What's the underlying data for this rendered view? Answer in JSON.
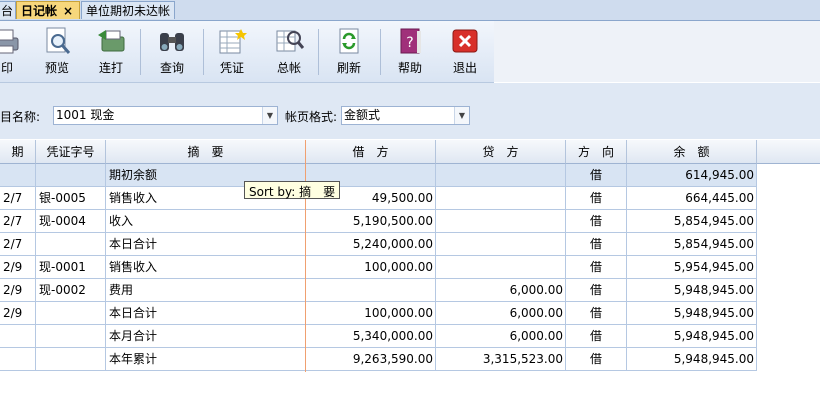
{
  "tabs": [
    {
      "label": "台",
      "active": false
    },
    {
      "label": "日记帐",
      "active": true,
      "close": "×"
    },
    {
      "label": "单位期初未达帐",
      "active": false
    }
  ],
  "toolbar": {
    "print": "印",
    "preview": "预览",
    "batch_print": "连打",
    "query": "查询",
    "voucher": "凭证",
    "ledger": "总帐",
    "refresh": "刷新",
    "help": "帮助",
    "exit": "退出"
  },
  "filters": {
    "subject_label": "目名称:",
    "subject_value": "1001 现金",
    "format_label": "帐页格式:",
    "format_value": "金额式"
  },
  "grid": {
    "headers": [
      "期",
      "凭证字号",
      "摘　要",
      "借　方",
      "贷　方",
      "方　向",
      "余　额"
    ],
    "rows": [
      {
        "date": "",
        "voucher": "",
        "summary": "期初余额",
        "debit": "",
        "credit": "",
        "dir": "借",
        "balance": "614,945.00"
      },
      {
        "date": "2/7",
        "voucher": "银-0005",
        "summary": "销售收入",
        "debit": "49,500.00",
        "credit": "",
        "dir": "借",
        "balance": "664,445.00"
      },
      {
        "date": "2/7",
        "voucher": "现-0004",
        "summary": "收入",
        "debit": "5,190,500.00",
        "credit": "",
        "dir": "借",
        "balance": "5,854,945.00"
      },
      {
        "date": "2/7",
        "voucher": "",
        "summary": "本日合计",
        "debit": "5,240,000.00",
        "credit": "",
        "dir": "借",
        "balance": "5,854,945.00"
      },
      {
        "date": "2/9",
        "voucher": "现-0001",
        "summary": "销售收入",
        "debit": "100,000.00",
        "credit": "",
        "dir": "借",
        "balance": "5,954,945.00"
      },
      {
        "date": "2/9",
        "voucher": "现-0002",
        "summary": "费用",
        "debit": "",
        "credit": "6,000.00",
        "dir": "借",
        "balance": "5,948,945.00"
      },
      {
        "date": "2/9",
        "voucher": "",
        "summary": "本日合计",
        "debit": "100,000.00",
        "credit": "6,000.00",
        "dir": "借",
        "balance": "5,948,945.00"
      },
      {
        "date": "",
        "voucher": "",
        "summary": "本月合计",
        "debit": "5,340,000.00",
        "credit": "6,000.00",
        "dir": "借",
        "balance": "5,948,945.00"
      },
      {
        "date": "",
        "voucher": "",
        "summary": "本年累计",
        "debit": "9,263,590.00",
        "credit": "3,315,523.00",
        "dir": "借",
        "balance": "5,948,945.00"
      }
    ]
  },
  "tooltip": "Sort by: 摘　要"
}
